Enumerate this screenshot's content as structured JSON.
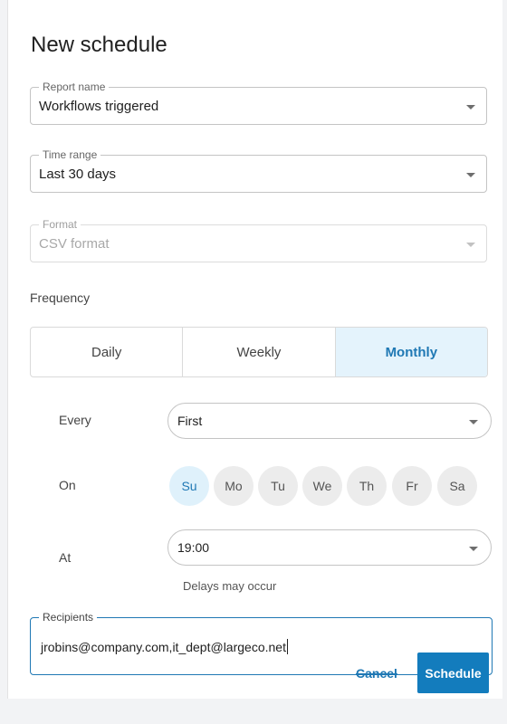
{
  "dialog": {
    "title": "New schedule"
  },
  "report_name": {
    "label": "Report name",
    "value": "Workflows triggered"
  },
  "time_range": {
    "label": "Time range",
    "value": "Last 30 days"
  },
  "format": {
    "label": "Format",
    "value": "CSV format",
    "disabled": true
  },
  "frequency": {
    "label": "Frequency",
    "options": [
      "Daily",
      "Weekly",
      "Monthly"
    ],
    "selected": "Monthly"
  },
  "every": {
    "label": "Every",
    "value": "First"
  },
  "on": {
    "label": "On",
    "days": [
      "Su",
      "Mo",
      "Tu",
      "We",
      "Th",
      "Fr",
      "Sa"
    ],
    "selected": "Su"
  },
  "at": {
    "label": "At",
    "value": "19:00",
    "note": "Delays may occur"
  },
  "recipients": {
    "label": "Recipients",
    "value": "jrobins@company.com,it_dept@largeco.net"
  },
  "actions": {
    "cancel_label": "Cancel",
    "schedule_label": "Schedule"
  },
  "colors": {
    "accent": "#1f78b4",
    "primary_button": "#137cbd",
    "selected_bg": "#e4f3fc"
  }
}
